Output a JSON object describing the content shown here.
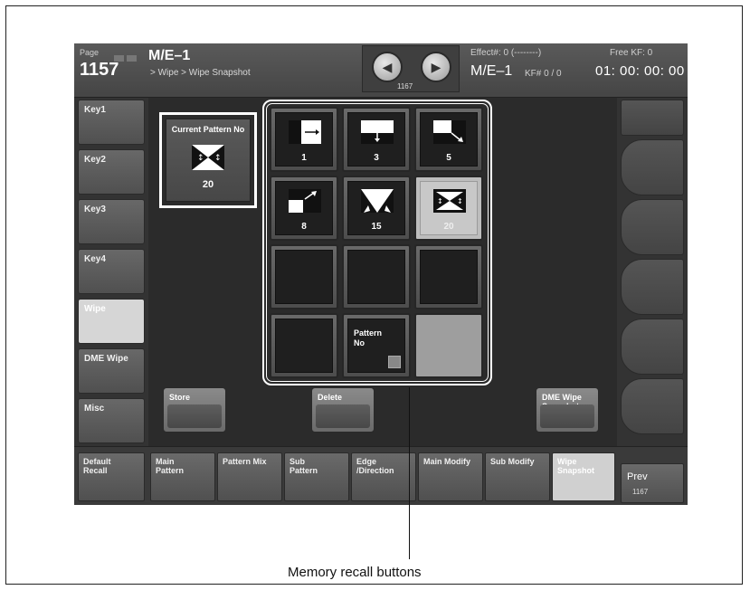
{
  "header": {
    "page_label": "Page",
    "page_number": "1157",
    "menu_title": "M/E–1",
    "breadcrumb": "> Wipe > Wipe Snapshot",
    "nav_number": "1167",
    "effect": "Effect#: 0 (--------)",
    "free_kf": "Free KF: 0",
    "me_id": "M/E–1",
    "kf": "KF# 0 / 0",
    "timecode": "01: 00: 00: 00"
  },
  "left_menu": [
    {
      "label": "Key1",
      "active": false
    },
    {
      "label": "Key2",
      "active": false
    },
    {
      "label": "Key3",
      "active": false
    },
    {
      "label": "Key4",
      "active": false
    },
    {
      "label": "Wipe",
      "active": true
    },
    {
      "label": "DME Wipe",
      "active": false
    },
    {
      "label": "Misc",
      "active": false
    }
  ],
  "current_pattern": {
    "label": "Current Pattern No",
    "number": "20",
    "icon": "wipe-pattern-20-icon"
  },
  "memory_buttons": [
    {
      "number": "1",
      "icon": "wipe-pattern-1-icon"
    },
    {
      "number": "3",
      "icon": "wipe-pattern-3-icon"
    },
    {
      "number": "5",
      "icon": "wipe-pattern-5-icon"
    },
    {
      "number": "8",
      "icon": "wipe-pattern-8-icon"
    },
    {
      "number": "15",
      "icon": "wipe-pattern-15-icon"
    },
    {
      "number": "20",
      "icon": "wipe-pattern-20-icon",
      "selected": true
    }
  ],
  "pattern_no_button": {
    "label_line1": "Pattern",
    "label_line2": "No",
    "icon": "keypad-icon"
  },
  "actions": {
    "store": "Store",
    "delete": "Delete",
    "dme_line1": "DME Wipe",
    "dme_line2": "Snapshot"
  },
  "bottom_tabs": {
    "default_recall": [
      "Default",
      "Recall"
    ],
    "main_pattern": [
      "Main",
      "Pattern"
    ],
    "pattern_mix": "Pattern Mix",
    "sub_pattern": [
      "Sub",
      "Pattern"
    ],
    "edge_direction": [
      "Edge",
      "/Direction"
    ],
    "main_modify": "Main Modify",
    "sub_modify": "Sub Modify",
    "wipe_snapshot": [
      "Wipe",
      "Snapshot"
    ],
    "prev_label": "Prev",
    "prev_number": "1167"
  },
  "callout": "Memory recall buttons",
  "colors": {
    "panel_bg": "#2b2b2b",
    "highlight": "#ffffff",
    "active_tab": "#d0d0d0"
  }
}
